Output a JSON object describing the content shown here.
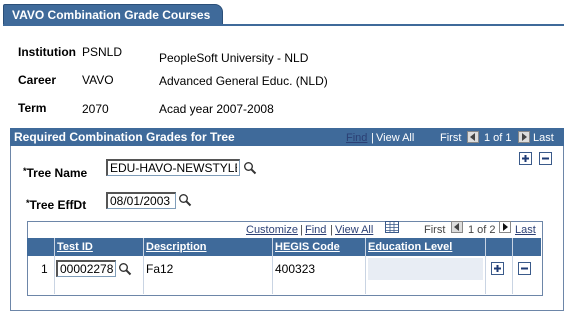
{
  "page": {
    "tab_title": "VAVO Combination Grade Courses"
  },
  "info": {
    "institution": {
      "label": "Institution",
      "code": "PSNLD",
      "desc": "PeopleSoft University -  NLD"
    },
    "career": {
      "label": "Career",
      "code": "VAVO",
      "desc": "Advanced General Educ. (NLD)"
    },
    "term": {
      "label": "Term",
      "code": "2070",
      "desc": "Acad year 2007-2008"
    }
  },
  "group": {
    "title": "Required Combination Grades for Tree",
    "nav": {
      "find": "Find",
      "sep": "|",
      "view_all": "View All",
      "first": "First",
      "position": "1 of 1",
      "last": "Last"
    },
    "tree_name": {
      "label": "Tree Name",
      "required": "*",
      "value": "EDU-HAVO-NEWSTYLE"
    },
    "tree_effdt": {
      "label": "Tree EffDt",
      "required": "*",
      "value": "08/01/2003"
    }
  },
  "grid": {
    "nav": {
      "customize": "Customize",
      "sep": "|",
      "find": "Find",
      "view_all": "View All",
      "first": "First",
      "position": "1 of 2",
      "last": "Last"
    },
    "columns": [
      "Test ID",
      "Description",
      "HEGIS Code",
      "Education Level"
    ],
    "rows": [
      {
        "num": "1",
        "test_id": "00002278",
        "description": "Fa12",
        "hegis_code": "400323",
        "education_level": ""
      }
    ]
  },
  "colors": {
    "header_bg": "#3f6a9a",
    "link": "#2b3f74"
  },
  "icons": [
    "search-icon",
    "add-icon",
    "delete-icon",
    "first-arrow-icon",
    "next-arrow-icon",
    "grid-download-icon"
  ]
}
